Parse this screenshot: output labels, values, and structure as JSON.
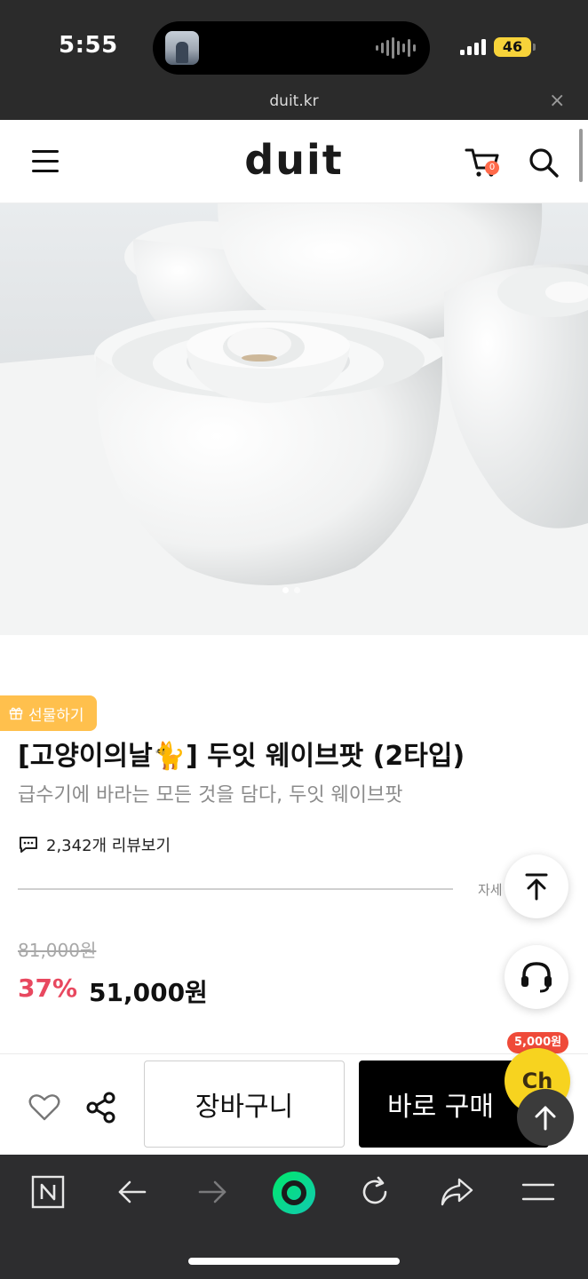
{
  "status_bar": {
    "time": "5:55",
    "battery": "46",
    "icons": [
      "signal-icon",
      "battery-icon",
      "now-playing-icon",
      "audio-wave-icon"
    ]
  },
  "browser": {
    "url": "duit.kr",
    "close_label": "×",
    "toolbar_icons": [
      "naver-n-icon",
      "back-arrow-icon",
      "forward-arrow-icon",
      "green-dot-home-icon",
      "reload-icon",
      "share-arrow-icon",
      "menu-lines-icon"
    ]
  },
  "header": {
    "logo": "duit",
    "cart_count": "0",
    "icons": [
      "hamburger-menu-icon",
      "cart-icon",
      "search-icon"
    ]
  },
  "hero": {
    "slide_index": 1,
    "slide_total": 2
  },
  "product": {
    "gift_label": "선물하기",
    "title": "[고양이의날🐈] 두잇 웨이브팟 (2타입)",
    "subtitle": "급수기에 바라는 모든 것을 담다, 두잇 웨이브팟",
    "review_label": "2,342개 리뷰보기",
    "detail_more": "자세",
    "original_price": "81,000원",
    "discount": "37%",
    "sale_price": "51,000원"
  },
  "actions": {
    "cart_button": "장바구니",
    "buy_button": "바로 구매",
    "channel_label": "Ch",
    "channel_badge": "5,000원"
  },
  "colors": {
    "discount": "#e8485f",
    "gift": "#ffc04d",
    "channel": "#f7d31f",
    "badge": "#ef4a39",
    "browser_bar": "#2d2d2f"
  }
}
